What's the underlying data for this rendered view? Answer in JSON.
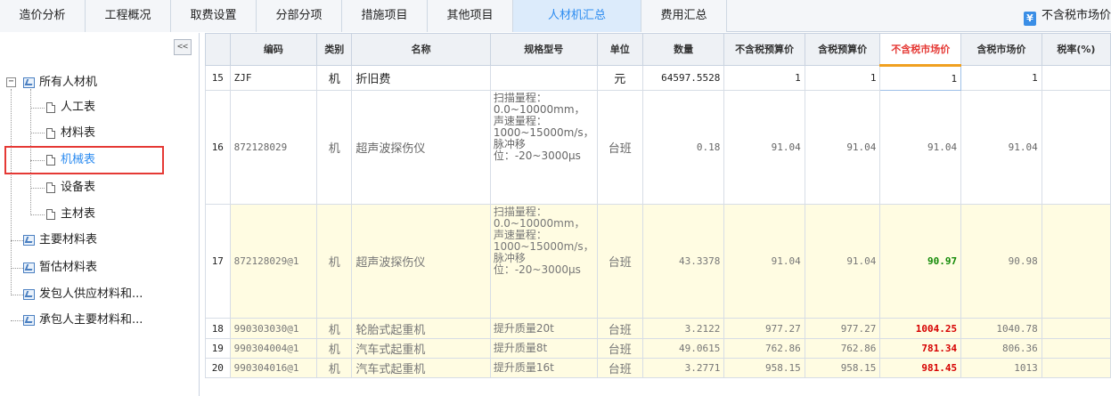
{
  "tabs": [
    {
      "label": "造价分析",
      "active": false
    },
    {
      "label": "工程概况",
      "active": false
    },
    {
      "label": "取费设置",
      "active": false
    },
    {
      "label": "分部分项",
      "active": false
    },
    {
      "label": "措施项目",
      "active": false
    },
    {
      "label": "其他项目",
      "active": false
    },
    {
      "label": "人材机汇总",
      "active": true
    },
    {
      "label": "费用汇总",
      "active": false
    }
  ],
  "toolbar_right": {
    "icon": "yen-icon",
    "label": "不含税市场价"
  },
  "tree": {
    "collapse_label": "<<",
    "expand_symbol": "−",
    "root": "所有人材机",
    "children": [
      "人工表",
      "材料表",
      "机械表",
      "设备表",
      "主材表"
    ],
    "selected": "机械表",
    "others": [
      "主要材料表",
      "暂估材料表",
      "发包人供应材料和...",
      "承包人主要材料和..."
    ]
  },
  "columns": [
    "编码",
    "类别",
    "名称",
    "规格型号",
    "单位",
    "数量",
    "不含税预算价",
    "含税预算价",
    "不含税市场价",
    "含税市场价",
    "税率(%)"
  ],
  "rows": [
    {
      "n": "15",
      "code": "ZJF",
      "type": "机",
      "name": "折旧费",
      "spec": "",
      "unit": "元",
      "qty": "64597.5528",
      "p1": "1",
      "p2": "1",
      "p3": "1",
      "p4": "1",
      "tax": ""
    },
    {
      "n": "16",
      "code": "872128029",
      "type": "机",
      "name": "超声波探伤仪",
      "spec": "扫描量程：0.0~10000mm，声速量程：1000~15000m/s，脉冲移位：-20~3000μs",
      "unit": "台班",
      "qty": "0.18",
      "p1": "91.04",
      "p2": "91.04",
      "p3": "91.04",
      "p4": "91.04",
      "tax": ""
    },
    {
      "n": "17",
      "code": "872128029@1",
      "type": "机",
      "name": "超声波探伤仪",
      "spec": "扫描量程：0.0~10000mm，声速量程：1000~15000m/s，脉冲移位：-20~3000μs",
      "unit": "台班",
      "qty": "43.3378",
      "p1": "91.04",
      "p2": "91.04",
      "p3": "90.97",
      "p4": "90.98",
      "tax": ""
    },
    {
      "n": "18",
      "code": "990303030@1",
      "type": "机",
      "name": "轮胎式起重机",
      "spec": "提升质量20t",
      "unit": "台班",
      "qty": "3.2122",
      "p1": "977.27",
      "p2": "977.27",
      "p3": "1004.25",
      "p4": "1040.78",
      "tax": ""
    },
    {
      "n": "19",
      "code": "990304004@1",
      "type": "机",
      "name": "汽车式起重机",
      "spec": "提升质量8t",
      "unit": "台班",
      "qty": "49.0615",
      "p1": "762.86",
      "p2": "762.86",
      "p3": "781.34",
      "p4": "806.36",
      "tax": ""
    },
    {
      "n": "20",
      "code": "990304016@1",
      "type": "机",
      "name": "汽车式起重机",
      "spec": "提升质量16t",
      "unit": "台班",
      "qty": "3.2771",
      "p1": "958.15",
      "p2": "958.15",
      "p3": "981.45",
      "p4": "1013",
      "tax": ""
    }
  ]
}
